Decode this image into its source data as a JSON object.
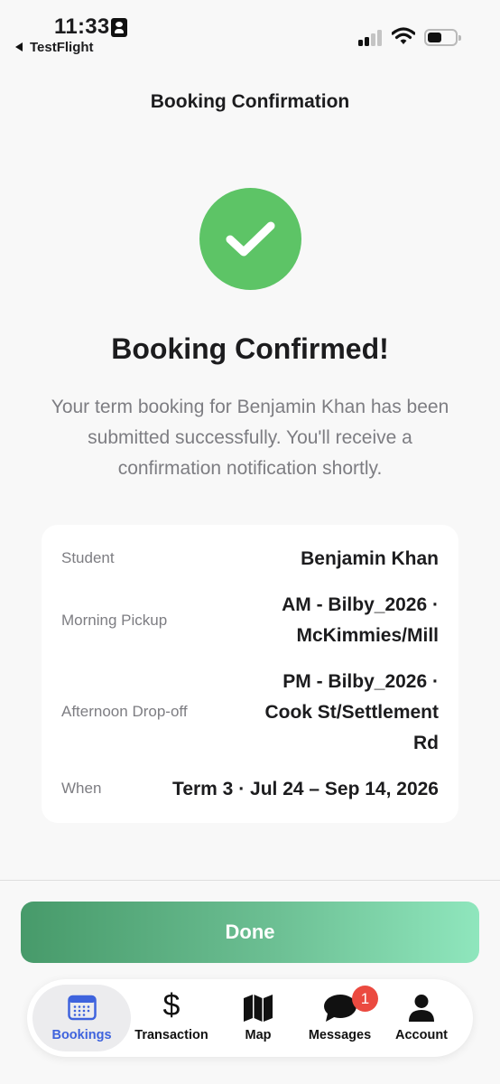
{
  "status_bar": {
    "time": "11:33",
    "back_app": "TestFlight"
  },
  "nav": {
    "title": "Booking Confirmation"
  },
  "confirmation": {
    "headline": "Booking Confirmed!",
    "message": "Your term booking for Benjamin Khan has been submitted successfully. You'll receive a confirmation notification shortly."
  },
  "details": [
    {
      "label": "Student",
      "value_lines": [
        "Benjamin Khan"
      ]
    },
    {
      "label": "Morning Pickup",
      "value_lines": [
        "AM - Bilby_2026 ·",
        "McKimmies/Mill"
      ]
    },
    {
      "label": "Afternoon Drop-off",
      "value_lines": [
        "PM - Bilby_2026 ·",
        "Cook St/Settlement",
        "Rd"
      ]
    },
    {
      "label": "When",
      "value_lines": [
        "Term 3 · Jul 24 – Sep 14, 2026"
      ]
    }
  ],
  "done_button": {
    "label": "Done"
  },
  "tab_bar": {
    "tabs": [
      {
        "label": "Bookings",
        "icon": "calendar-icon",
        "active": true
      },
      {
        "label": "Transaction",
        "icon": "dollar-icon",
        "active": false
      },
      {
        "label": "Map",
        "icon": "map-icon",
        "active": false
      },
      {
        "label": "Messages",
        "icon": "chat-bubble-icon",
        "active": false
      },
      {
        "label": "Account",
        "icon": "person-icon",
        "active": false
      }
    ],
    "messages_badge": "1"
  },
  "colors": {
    "success_green": "#5dc466",
    "active_tab_blue": "#3e63dd",
    "badge_red": "#eb4a40",
    "done_gradient_start": "#479a6a",
    "done_gradient_end": "#8fe6bd"
  }
}
